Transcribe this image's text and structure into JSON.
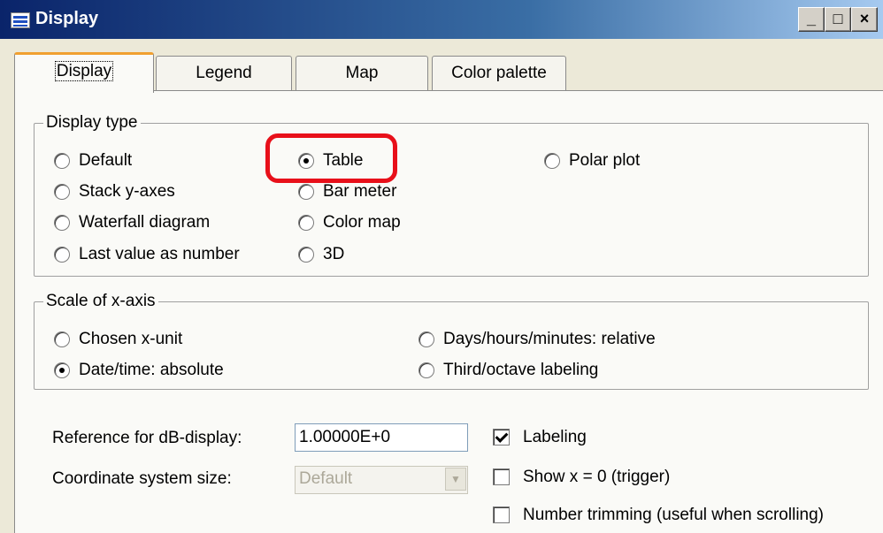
{
  "window": {
    "title": "Display",
    "minimize_label": "_",
    "maximize_label": "□",
    "close_label": "×"
  },
  "tabs": [
    {
      "label": "Display",
      "active": true
    },
    {
      "label": "Legend",
      "active": false
    },
    {
      "label": "Map",
      "active": false
    },
    {
      "label": "Color palette",
      "active": false
    }
  ],
  "display_type": {
    "label": "Display type",
    "options": [
      {
        "label": "Default",
        "checked": false
      },
      {
        "label": "Stack y-axes",
        "checked": false
      },
      {
        "label": "Waterfall diagram",
        "checked": false
      },
      {
        "label": "Last value as number",
        "checked": false
      },
      {
        "label": "Table",
        "checked": true
      },
      {
        "label": "Bar meter",
        "checked": false
      },
      {
        "label": "Color map",
        "checked": false
      },
      {
        "label": "3D",
        "checked": false
      },
      {
        "label": "Polar plot",
        "checked": false
      }
    ]
  },
  "scale_x_axis": {
    "label": "Scale of x-axis",
    "options": [
      {
        "label": "Chosen x-unit",
        "checked": false
      },
      {
        "label": "Date/time: absolute",
        "checked": true
      },
      {
        "label": "Days/hours/minutes: relative",
        "checked": false
      },
      {
        "label": "Third/octave labeling",
        "checked": false
      }
    ]
  },
  "reference_db": {
    "label": "Reference for dB-display:",
    "value": "1.00000E+0"
  },
  "coord_size": {
    "label": "Coordinate system size:",
    "value": "Default"
  },
  "checkboxes": [
    {
      "label": "Labeling",
      "checked": true
    },
    {
      "label": "Show x = 0 (trigger)",
      "checked": false
    },
    {
      "label": "Number trimming (useful when scrolling)",
      "checked": false
    }
  ],
  "colors": {
    "titlebar": "#0a246a",
    "highlight": "#e8101a",
    "active_tab_accent": "#f0a030"
  }
}
